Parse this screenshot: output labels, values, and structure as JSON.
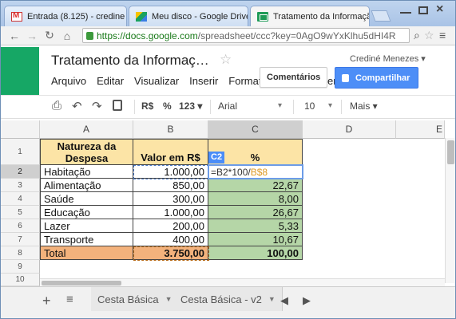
{
  "browser": {
    "tabs": [
      {
        "label": "Entrada (8.125) - credine",
        "icon": "gmail-icon"
      },
      {
        "label": "Meu disco - Google Drive",
        "icon": "drive-icon"
      },
      {
        "label": "Tratamento da Informaçã",
        "icon": "sheets-icon"
      }
    ],
    "close_glyph": "×",
    "url_host": "https://docs.google.com",
    "url_path": "/spreadsheet/ccc?key=0AgO9wYxKlhu5dHI4R"
  },
  "doc": {
    "title": "Tratamento da Informaç…",
    "user": "Crediné Menezes ▾",
    "menu": [
      "Arquivo",
      "Editar",
      "Visualizar",
      "Inserir",
      "Format",
      "er"
    ],
    "comments_label": "Comentários",
    "share_label": "Compartilhar"
  },
  "toolbar": {
    "currency": "R$",
    "percent": "%",
    "number_format": "123 ▾",
    "font": "Arial",
    "font_arrow": "▾",
    "size": "10",
    "size_arrow": "▾",
    "more": "Mais ▾"
  },
  "columns": [
    "A",
    "B",
    "C",
    "D",
    "E"
  ],
  "rows": [
    "1",
    "2",
    "3",
    "4",
    "5",
    "6",
    "7",
    "8",
    "9",
    "10"
  ],
  "table": {
    "header": {
      "a_line1": "Natureza da",
      "a_line2": "Despesa",
      "b": "Valor em R$",
      "c": "%"
    },
    "data": [
      {
        "a": "Habitação",
        "b": "1.000,00",
        "c": ""
      },
      {
        "a": "Alimentação",
        "b": "850,00",
        "c": "22,67"
      },
      {
        "a": "Saúde",
        "b": "300,00",
        "c": "8,00"
      },
      {
        "a": "Educação",
        "b": "1.000,00",
        "c": "26,67"
      },
      {
        "a": "Lazer",
        "b": "200,00",
        "c": "5,33"
      },
      {
        "a": "Transporte",
        "b": "400,00",
        "c": "10,67"
      }
    ],
    "total": {
      "a": "Total",
      "b": "3.750,00",
      "c": "100,00"
    }
  },
  "editor": {
    "cell_ref": "C2",
    "formula_prefix": "=B2*100/",
    "formula_ref": "B$8"
  },
  "sheets": [
    {
      "label": "Cesta Básica"
    },
    {
      "label": "Cesta Básica - v2"
    }
  ],
  "colors": {
    "header_fill": "#fce4a6",
    "percent_fill": "#b5d6a7",
    "total_fill": "#f3b27c",
    "share_blue": "#4d8ef7",
    "sheets_green": "#16a765"
  }
}
